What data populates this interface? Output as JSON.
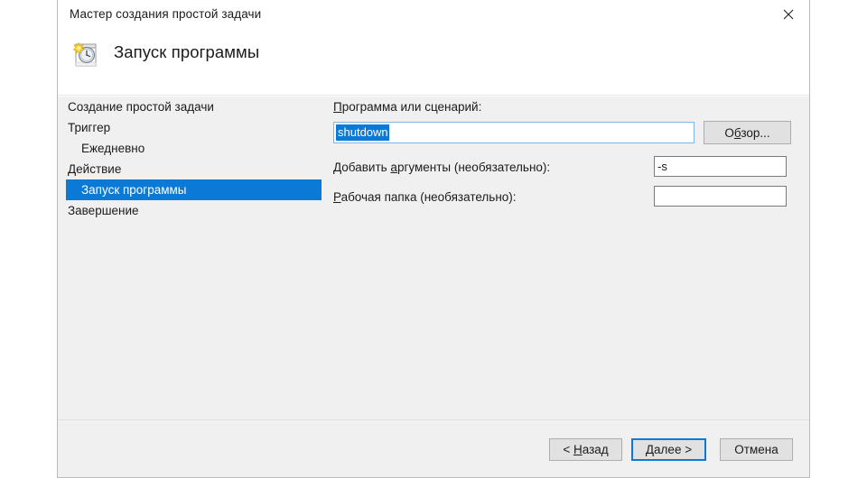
{
  "window": {
    "title": "Мастер создания простой задачи",
    "close_icon": "close-icon"
  },
  "header": {
    "icon": "scheduled-task-icon",
    "title": "Запуск программы"
  },
  "sidebar": {
    "items": [
      {
        "label": "Создание простой задачи",
        "level": 0,
        "selected": false
      },
      {
        "label": "Триггер",
        "level": 0,
        "selected": false
      },
      {
        "label": "Ежедневно",
        "level": 1,
        "selected": false
      },
      {
        "label": "Действие",
        "level": 0,
        "selected": false
      },
      {
        "label": "Запуск программы",
        "level": 1,
        "selected": true
      },
      {
        "label": "Завершение",
        "level": 0,
        "selected": false
      }
    ]
  },
  "form": {
    "program_label_acc": "П",
    "program_label_rest": "рограмма или сценарий:",
    "program_value": "shutdown",
    "program_placeholder": "",
    "browse_acc_pre": "О",
    "browse_acc": "б",
    "browse_acc_post": "зор...",
    "arguments_label_pre": "Добавить ",
    "arguments_label_acc": "а",
    "arguments_label_post": "ргументы (необязательно):",
    "arguments_value": "-s",
    "arguments_placeholder": "",
    "workdir_label_acc": "Р",
    "workdir_label_rest": "абочая папка (необязательно):",
    "workdir_value": "",
    "workdir_placeholder": ""
  },
  "footer": {
    "back_pre": "< ",
    "back_acc": "Н",
    "back_post": "азад",
    "next_acc": "Д",
    "next_post": "алее >",
    "cancel_label": "Отмена"
  },
  "colors": {
    "accent": "#0b79d6",
    "dialog_bg": "#f0f0f0",
    "header_bg": "#ffffff",
    "button_bg": "#e1e1e1",
    "text": "#1b1b1b"
  }
}
